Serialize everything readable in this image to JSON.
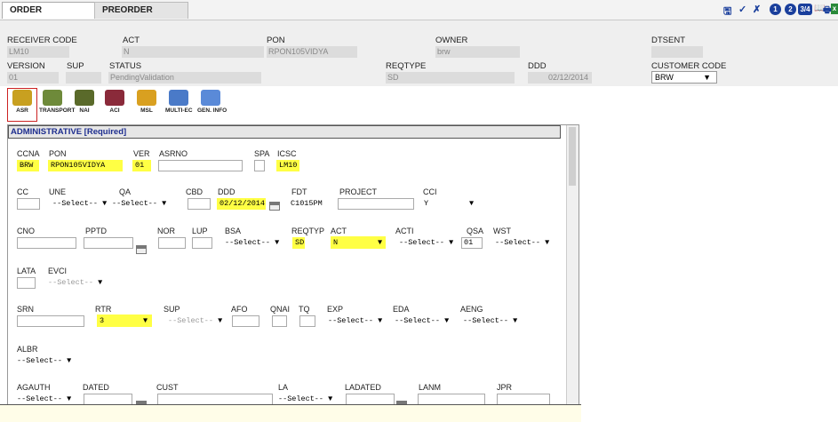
{
  "tabs": {
    "order": "ORDER",
    "preorder": "PREORDER"
  },
  "toolbar": {
    "save": "🖫",
    "check": "✓",
    "flag": "✗",
    "one": "1",
    "two": "2",
    "three_four": "3/4",
    "book": "📖",
    "print": "🖶",
    "excel": "x"
  },
  "header": {
    "receiver_code": {
      "label": "RECEIVER CODE",
      "value": "LM10"
    },
    "act": {
      "label": "ACT",
      "value": "N"
    },
    "pon": {
      "label": "PON",
      "value": "RPON105VIDYA"
    },
    "owner": {
      "label": "OWNER",
      "value": "brw"
    },
    "dtsent": {
      "label": "DTSENT",
      "value": ""
    },
    "version": {
      "label": "VERSION",
      "value": "01"
    },
    "sup": {
      "label": "SUP",
      "value": ""
    },
    "status": {
      "label": "STATUS",
      "value": "PendingValidation"
    },
    "reqtype": {
      "label": "REQTYPE",
      "value": "SD"
    },
    "ddd": {
      "label": "DDD",
      "value": "02/12/2014"
    },
    "customer_code": {
      "label": "CUSTOMER CODE",
      "value": "BRW"
    }
  },
  "icon_tabs": [
    {
      "label": "ASR",
      "icon": "asr-icon",
      "color": "#c8a020"
    },
    {
      "label": "TRANSPORT",
      "icon": "transport-icon",
      "color": "#6e8a3a"
    },
    {
      "label": "NAI",
      "icon": "nai-icon",
      "color": "#5a6a2a"
    },
    {
      "label": "ACI",
      "icon": "aci-icon",
      "color": "#8a2a3a"
    },
    {
      "label": "MSL",
      "icon": "msl-icon",
      "color": "#d9a020"
    },
    {
      "label": "MULTI-EC",
      "icon": "multi-ec-icon",
      "color": "#4a7ac8"
    },
    {
      "label": "GEN. INFO",
      "icon": "gen-info-icon",
      "color": "#5a8ad8"
    }
  ],
  "section_title": "ADMINISTRATIVE [Required]",
  "form": {
    "ccna": {
      "label": "CCNA",
      "value": "BRW"
    },
    "pon": {
      "label": "PON",
      "value": "RPON105VIDYA"
    },
    "ver": {
      "label": "VER",
      "value": "01"
    },
    "asrno": {
      "label": "ASRNO",
      "value": ""
    },
    "spa": {
      "label": "SPA",
      "value": ""
    },
    "icsc": {
      "label": "ICSC",
      "value": "LM10"
    },
    "cc": {
      "label": "CC",
      "value": ""
    },
    "une": {
      "label": "UNE",
      "value": "--Select--"
    },
    "qa": {
      "label": "QA",
      "value": "--Select--"
    },
    "cbd": {
      "label": "CBD",
      "value": ""
    },
    "ddd": {
      "label": "DDD",
      "value": "02/12/2014"
    },
    "fdt": {
      "label": "FDT",
      "value": "C1015PM"
    },
    "project": {
      "label": "PROJECT",
      "value": ""
    },
    "cci": {
      "label": "CCI",
      "value": "Y"
    },
    "cno": {
      "label": "CNO",
      "value": ""
    },
    "pptd": {
      "label": "PPTD",
      "value": ""
    },
    "nor": {
      "label": "NOR",
      "value": ""
    },
    "lup": {
      "label": "LUP",
      "value": ""
    },
    "bsa": {
      "label": "BSA",
      "value": "--Select--"
    },
    "reqtyp": {
      "label": "REQTYP",
      "value": "SD"
    },
    "act": {
      "label": "ACT",
      "value": "N"
    },
    "acti": {
      "label": "ACTI",
      "value": "--Select--"
    },
    "qsa": {
      "label": "QSA",
      "value": "01"
    },
    "wst": {
      "label": "WST",
      "value": "--Select--"
    },
    "lata": {
      "label": "LATA",
      "value": ""
    },
    "evci": {
      "label": "EVCI",
      "value": "--Select--"
    },
    "srn": {
      "label": "SRN",
      "value": ""
    },
    "rtr": {
      "label": "RTR",
      "value": "3"
    },
    "sup": {
      "label": "SUP",
      "value": "--Select--"
    },
    "afo": {
      "label": "AFO",
      "value": ""
    },
    "qnai": {
      "label": "QNAI",
      "value": ""
    },
    "tq": {
      "label": "TQ",
      "value": ""
    },
    "exp": {
      "label": "EXP",
      "value": "--Select--"
    },
    "eda": {
      "label": "EDA",
      "value": "--Select--"
    },
    "aeng": {
      "label": "AENG",
      "value": "--Select--"
    },
    "albr": {
      "label": "ALBR",
      "value": "--Select--"
    },
    "agauth": {
      "label": "AGAUTH",
      "value": "--Select--"
    },
    "dated": {
      "label": "DATED",
      "value": ""
    },
    "cust": {
      "label": "CUST",
      "value": ""
    },
    "la": {
      "label": "LA",
      "value": "--Select--"
    },
    "ladated": {
      "label": "LADATED",
      "value": ""
    },
    "lanm": {
      "label": "LANM",
      "value": ""
    },
    "jpr": {
      "label": "JPR",
      "value": ""
    }
  }
}
